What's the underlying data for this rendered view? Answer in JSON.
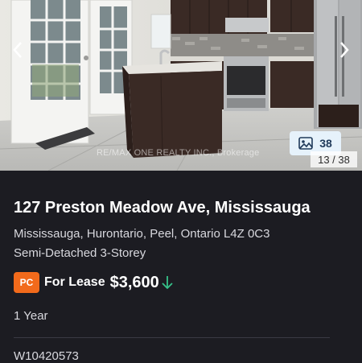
{
  "photo": {
    "watermark": "RE/MAX ONE REALTY INC., Brokerage",
    "photo_count": "38",
    "photo_index": "13 / 38",
    "icons": {
      "prev": "chevron-left-icon",
      "next": "chevron-right-icon",
      "gallery": "image-gallery-icon"
    }
  },
  "listing": {
    "address": "127 Preston Meadow Ave, Mississauga",
    "location": "Mississauga, Hurontario, Peel, Ontario L4Z 0C3",
    "property_type": "Semi-Detached 3-Storey",
    "badge": "PC",
    "lease_label": "For Lease",
    "price": "$3,600",
    "price_trend_icon": "arrow-down-icon",
    "term": "1 Year",
    "mls_number": "W10420573"
  },
  "colors": {
    "background": "#1c1c22",
    "badge": "#f26a1b",
    "trend": "#36c28a",
    "count_badge": "#e6f2fb"
  }
}
